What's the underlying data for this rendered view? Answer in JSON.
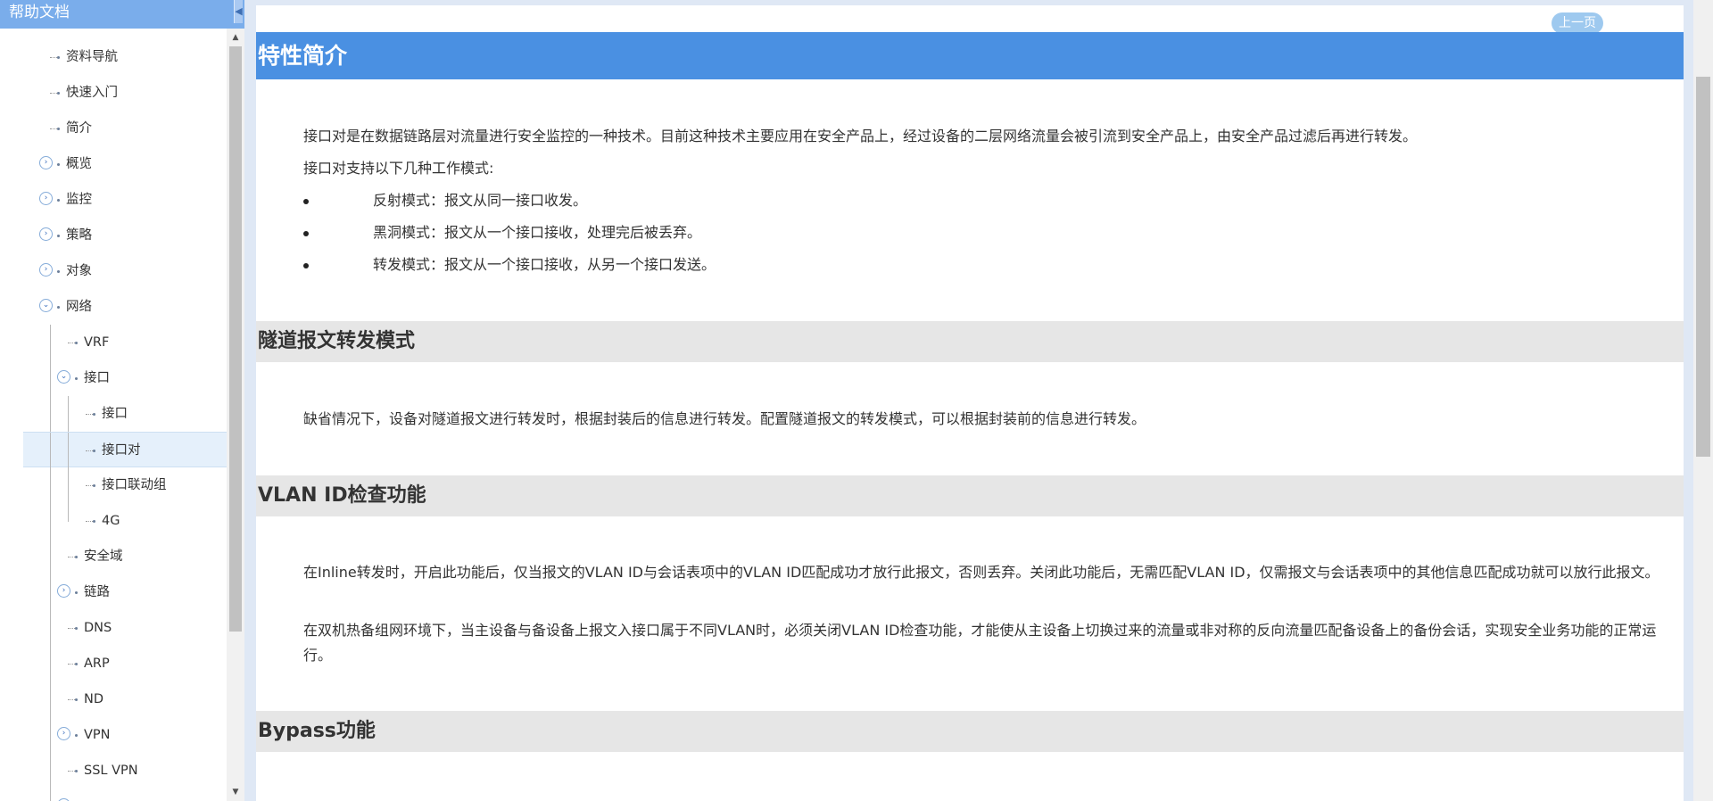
{
  "sidebar": {
    "title": "帮助文档",
    "collapse_icon": "◀",
    "tree": [
      {
        "label": "资料导航",
        "level": 0,
        "expand": "none"
      },
      {
        "label": "快速入门",
        "level": 0,
        "expand": "none"
      },
      {
        "label": "简介",
        "level": 0,
        "expand": "none"
      },
      {
        "label": "概览",
        "level": 0,
        "expand": "collapsed"
      },
      {
        "label": "监控",
        "level": 0,
        "expand": "collapsed"
      },
      {
        "label": "策略",
        "level": 0,
        "expand": "collapsed"
      },
      {
        "label": "对象",
        "level": 0,
        "expand": "collapsed"
      },
      {
        "label": "网络",
        "level": 0,
        "expand": "expanded"
      },
      {
        "label": "VRF",
        "level": 1,
        "expand": "none"
      },
      {
        "label": "接口",
        "level": 1,
        "expand": "expanded"
      },
      {
        "label": "接口",
        "level": 2,
        "expand": "none"
      },
      {
        "label": "接口对",
        "level": 2,
        "expand": "none",
        "selected": true
      },
      {
        "label": "接口联动组",
        "level": 2,
        "expand": "none"
      },
      {
        "label": "4G",
        "level": 2,
        "expand": "none",
        "last": true
      },
      {
        "label": "安全域",
        "level": 1,
        "expand": "none"
      },
      {
        "label": "链路",
        "level": 1,
        "expand": "collapsed"
      },
      {
        "label": "DNS",
        "level": 1,
        "expand": "none"
      },
      {
        "label": "ARP",
        "level": 1,
        "expand": "none"
      },
      {
        "label": "ND",
        "level": 1,
        "expand": "none"
      },
      {
        "label": "VPN",
        "level": 1,
        "expand": "collapsed"
      },
      {
        "label": "SSL VPN",
        "level": 1,
        "expand": "none"
      },
      {
        "label": "",
        "level": 1,
        "expand": "collapsed"
      }
    ]
  },
  "content": {
    "prev_button": "上一页",
    "title": "特性简介",
    "intro": [
      "接口对是在数据链路层对流量进行安全监控的一种技术。目前这种技术主要应用在安全产品上，经过设备的二层网络流量会被引流到安全产品上，由安全产品过滤后再进行转发。",
      "接口对支持以下几种工作模式:"
    ],
    "modes": [
      "反射模式：报文从同一接口收发。",
      "黑洞模式：报文从一个接口接收，处理完后被丢弃。",
      "转发模式：报文从一个接口接收，从另一个接口发送。"
    ],
    "sections": [
      {
        "heading": "隧道报文转发模式",
        "paragraphs": [
          "缺省情况下，设备对隧道报文进行转发时，根据封装后的信息进行转发。配置隧道报文的转发模式，可以根据封装前的信息进行转发。"
        ]
      },
      {
        "heading": "VLAN ID检查功能",
        "paragraphs": [
          "在Inline转发时，开启此功能后，仅当报文的VLAN ID与会话表项中的VLAN ID匹配成功才放行此报文，否则丢弃。关闭此功能后，无需匹配VLAN ID，仅需报文与会话表项中的其他信息匹配成功就可以放行此报文。",
          "在双机热备组网环境下，当主设备与备设备上报文入接口属于不同VLAN时，必须关闭VLAN ID检查功能，才能使从主设备上切换过来的流量或非对称的反向流量匹配备设备上的备份会话，实现安全业务功能的正常运行。"
        ]
      },
      {
        "heading": "Bypass功能",
        "paragraphs": []
      }
    ]
  },
  "colors": {
    "title_bar": "#4a90e2",
    "sidebar_header": "#7aadeb",
    "section_bg": "#e6e6e6",
    "selected_bg": "#e5f0fb"
  }
}
